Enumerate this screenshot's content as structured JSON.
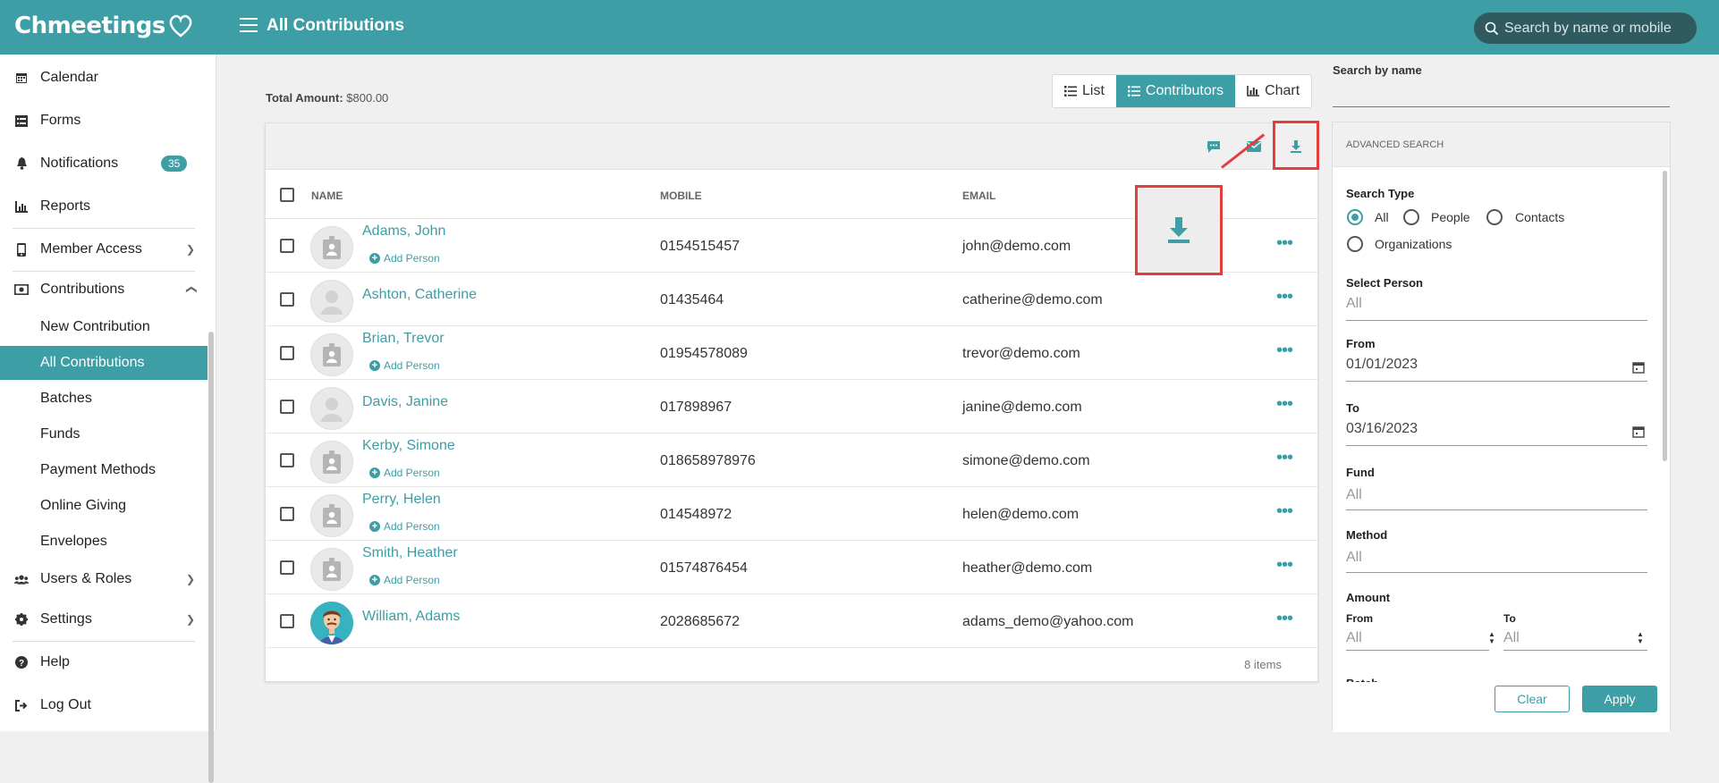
{
  "app": {
    "logo": "Chmeetings",
    "title": "All Contributions"
  },
  "top_search": {
    "placeholder": "Search by name or mobile"
  },
  "sidebar": {
    "items": [
      {
        "label": "Calendar",
        "icon": "calendar-icon"
      },
      {
        "label": "Forms",
        "icon": "forms-icon"
      },
      {
        "label": "Notifications",
        "icon": "bell-icon",
        "badge": "35"
      },
      {
        "label": "Reports",
        "icon": "chart-icon"
      },
      {
        "label": "Member Access",
        "icon": "mobile-icon"
      },
      {
        "label": "Contributions",
        "icon": "money-icon"
      },
      {
        "label": "Users & Roles",
        "icon": "users-icon"
      },
      {
        "label": "Settings",
        "icon": "gear-icon"
      },
      {
        "label": "Help",
        "icon": "help-icon"
      },
      {
        "label": "Log Out",
        "icon": "logout-icon"
      }
    ],
    "contributions_sub": [
      "New Contribution",
      "All Contributions",
      "Batches",
      "Funds",
      "Payment Methods",
      "Online Giving",
      "Envelopes"
    ]
  },
  "summary": {
    "total_label": "Total Amount:",
    "total_value": "$800.00"
  },
  "view_tabs": [
    "List",
    "Contributors",
    "Chart"
  ],
  "table": {
    "headers": {
      "name": "NAME",
      "mobile": "MOBILE",
      "email": "EMAIL"
    },
    "add_person_label": "Add Person",
    "rows": [
      {
        "name": "Adams, John",
        "mobile": "0154515457",
        "email": "john@demo.com",
        "add_person": true
      },
      {
        "name": "Ashton, Catherine",
        "mobile": "01435464",
        "email": "catherine@demo.com",
        "add_person": false
      },
      {
        "name": "Brian, Trevor",
        "mobile": "01954578089",
        "email": "trevor@demo.com",
        "add_person": true
      },
      {
        "name": "Davis, Janine",
        "mobile": "017898967",
        "email": "janine@demo.com",
        "add_person": false
      },
      {
        "name": "Kerby, Simone",
        "mobile": "018658978976",
        "email": "simone@demo.com",
        "add_person": true
      },
      {
        "name": "Perry, Helen",
        "mobile": "014548972",
        "email": "helen@demo.com",
        "add_person": true
      },
      {
        "name": "Smith, Heather",
        "mobile": "01574876454",
        "email": "heather@demo.com",
        "add_person": true
      },
      {
        "name": "William, Adams",
        "mobile": "2028685672",
        "email": "adams_demo@yahoo.com",
        "add_person": false
      }
    ],
    "items_count": "8 items"
  },
  "right_panel": {
    "search_by_name_label": "Search by name",
    "advanced_title": "ADVANCED SEARCH",
    "search_type_label": "Search Type",
    "search_type_options": [
      "All",
      "People",
      "Contacts",
      "Organizations"
    ],
    "search_type_selected": "All",
    "select_person_label": "Select Person",
    "select_person_value": "All",
    "from_label": "From",
    "from_value": "01/01/2023",
    "to_label": "To",
    "to_value": "03/16/2023",
    "fund_label": "Fund",
    "fund_value": "All",
    "method_label": "Method",
    "method_value": "All",
    "amount_label": "Amount",
    "amount_from_label": "From",
    "amount_from_value": "All",
    "amount_to_label": "To",
    "amount_to_value": "All",
    "batch_label": "Batch",
    "clear_label": "Clear",
    "apply_label": "Apply"
  },
  "colors": {
    "accent": "#3d9ea6",
    "highlight": "#e53c3c"
  }
}
